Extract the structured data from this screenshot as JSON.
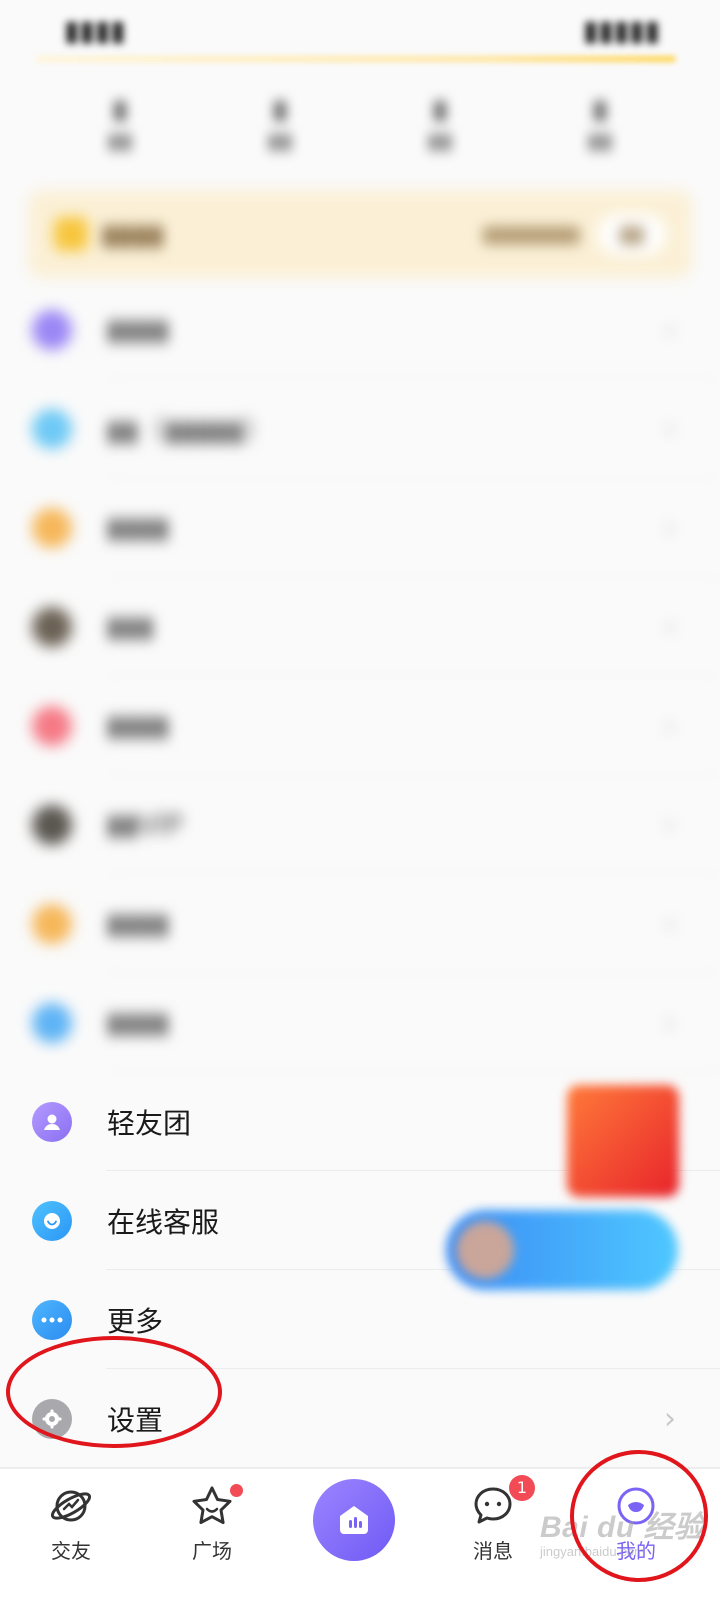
{
  "menu": {
    "items": [
      {
        "label": "轻友团"
      },
      {
        "label": "在线客服"
      },
      {
        "label": "更多"
      },
      {
        "label": "设置"
      }
    ]
  },
  "bottom_nav": {
    "items": [
      {
        "label": "交友",
        "icon": "planet-icon"
      },
      {
        "label": "广场",
        "icon": "star-icon",
        "dot": true
      },
      {
        "label": "",
        "icon": "voice-room-icon"
      },
      {
        "label": "消息",
        "icon": "chat-bubble-icon",
        "badge": "1"
      },
      {
        "label": "我的",
        "icon": "profile-face-icon",
        "active": true
      }
    ]
  },
  "watermark": {
    "line1": "Bai du 经验",
    "line2": "jingyan.baidu.com"
  },
  "colors": {
    "accent": "#6f5af5",
    "annotation": "#e0161c",
    "badge": "#f24b55"
  }
}
